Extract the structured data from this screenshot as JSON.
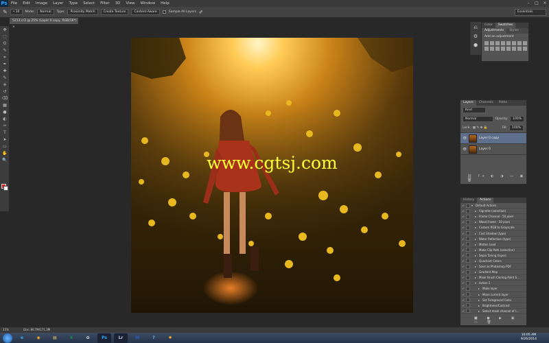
{
  "app": {
    "logo": "Ps"
  },
  "menu": [
    "File",
    "Edit",
    "Image",
    "Layer",
    "Type",
    "Select",
    "Filter",
    "3D",
    "View",
    "Window",
    "Help"
  ],
  "window_controls": [
    "–",
    "□",
    "×"
  ],
  "options_bar": {
    "mode_label": "Mode:",
    "mode_value": "Normal",
    "type_label": "Type:",
    "type_options": [
      "Proximity Match",
      "Create Texture",
      "Content-Aware"
    ],
    "sample_all_layers": "Sample All Layers"
  },
  "workspace": "Essentials",
  "document_tab": "5213.cr2 @ 25% (Layer 0 copy, RGB/16*) ×",
  "toolbar_icons": [
    "move-icon",
    "marquee-icon",
    "lasso-icon",
    "quick-select-icon",
    "crop-icon",
    "eyedropper-icon",
    "spot-heal-icon",
    "brush-icon",
    "stamp-icon",
    "history-brush-icon",
    "eraser-icon",
    "gradient-icon",
    "blur-icon",
    "dodge-icon",
    "pen-icon",
    "type-icon",
    "path-select-icon",
    "shape-icon",
    "hand-icon",
    "zoom-icon"
  ],
  "toolbar_glyphs": [
    "✥",
    "⬚",
    "ʘ",
    "✎",
    "⌗",
    "✒",
    "✚",
    "✎",
    "⎈",
    "↺",
    "⌫",
    "▦",
    "●",
    "◐",
    "✑",
    "T",
    "➤",
    "▭",
    "✋",
    "🔍"
  ],
  "colors": {
    "foreground": "#e02020",
    "background": "#ffffff"
  },
  "canvas": {
    "watermark": "www.cgtsj.com"
  },
  "status": {
    "zoom": "25%",
    "doc": "Doc: 86.7M/171.3M"
  },
  "adjustments_panel": {
    "tabs": [
      "Color",
      "Swatches"
    ],
    "subtabs": [
      "Adjustments",
      "Styles"
    ],
    "title": "Add an adjustment"
  },
  "layers_panel": {
    "tabs": [
      "Layers",
      "Channels",
      "Paths"
    ],
    "kind": "Kind",
    "blend": "Normal",
    "opacity_label": "Opacity:",
    "opacity": "100%",
    "lock_label": "Lock:",
    "fill_label": "Fill:",
    "fill": "100%",
    "layers": [
      {
        "name": "Layer 0 copy",
        "selected": true
      },
      {
        "name": "Layer 0",
        "selected": false
      }
    ]
  },
  "actions_panel": {
    "tabs": [
      "History",
      "Actions"
    ],
    "items": [
      {
        "name": "Default Actions",
        "indent": 0,
        "open": true
      },
      {
        "name": "Vignette (selection)",
        "indent": 1,
        "open": false
      },
      {
        "name": "Frame Channel - 50 pixel",
        "indent": 1,
        "open": false
      },
      {
        "name": "Wood Frame - 50 pixel",
        "indent": 1,
        "open": false
      },
      {
        "name": "Custom RGB to Grayscale",
        "indent": 1,
        "open": false
      },
      {
        "name": "Cast Shadow (type)",
        "indent": 1,
        "open": false
      },
      {
        "name": "Water Reflection (type)",
        "indent": 1,
        "open": false
      },
      {
        "name": "Molten Lead",
        "indent": 1,
        "open": false
      },
      {
        "name": "Make Clip Path (selection)",
        "indent": 1,
        "open": false
      },
      {
        "name": "Sepia Toning (layer)",
        "indent": 1,
        "open": false
      },
      {
        "name": "Quadrant Colors",
        "indent": 1,
        "open": false
      },
      {
        "name": "Save as Photoshop PDF",
        "indent": 1,
        "open": false
      },
      {
        "name": "Gradient Map",
        "indent": 1,
        "open": false
      },
      {
        "name": "Mixer Brush Cloning Paint S...",
        "indent": 1,
        "open": false
      },
      {
        "name": "Action 1",
        "indent": 1,
        "open": true
      },
      {
        "name": "Make layer",
        "indent": 2,
        "open": false
      },
      {
        "name": "Move current layer",
        "indent": 2,
        "open": false
      },
      {
        "name": "Set Foreground Color",
        "indent": 2,
        "open": false
      },
      {
        "name": "Brightness/Contrast",
        "indent": 2,
        "open": false
      },
      {
        "name": "Select mask channel of l...",
        "indent": 2,
        "open": false
      }
    ]
  },
  "taskbar": {
    "apps": [
      {
        "name": "ie",
        "glyph": "e",
        "color": "#3fa9f5"
      },
      {
        "name": "chrome",
        "glyph": "◉",
        "color": "#e8b422"
      },
      {
        "name": "explorer",
        "glyph": "▤",
        "color": "#e9c46a"
      },
      {
        "name": "excel",
        "glyph": "X",
        "color": "#1f8a4c"
      },
      {
        "name": "camtasia",
        "glyph": "✿",
        "color": "#e0e0e0"
      },
      {
        "name": "photoshop",
        "glyph": "Ps",
        "color": "#31a8ff"
      },
      {
        "name": "lightroom",
        "glyph": "Lr",
        "color": "#b8cbe0"
      },
      {
        "name": "word",
        "glyph": "W",
        "color": "#2b5fb4"
      },
      {
        "name": "help",
        "glyph": "?",
        "color": "#6ab0ff"
      },
      {
        "name": "settings",
        "glyph": "✹",
        "color": "#f0b030"
      }
    ],
    "time": "10:05 AM",
    "date": "9/26/2014"
  }
}
